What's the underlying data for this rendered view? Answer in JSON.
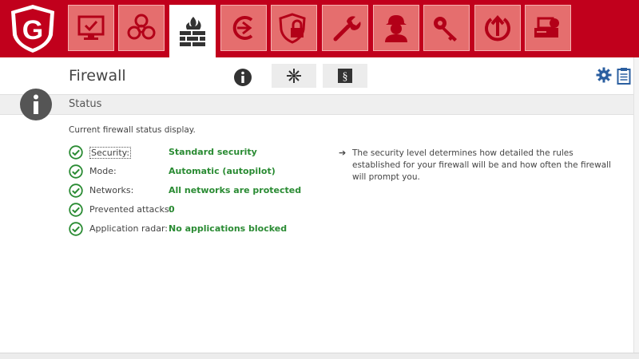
{
  "app": {
    "logo_letter": "G"
  },
  "modules": [
    {
      "name": "status-monitor-icon"
    },
    {
      "name": "biohazard-icon"
    },
    {
      "name": "firewall-icon"
    },
    {
      "name": "backup-icon"
    },
    {
      "name": "password-manager-icon"
    },
    {
      "name": "tuner-icon"
    },
    {
      "name": "parental-controls-icon"
    },
    {
      "name": "encryption-key-icon"
    },
    {
      "name": "autostart-manager-icon"
    },
    {
      "name": "device-control-icon"
    }
  ],
  "header": {
    "title": "Firewall",
    "subtabs": [
      {
        "name": "status-info-icon"
      },
      {
        "name": "network-icon"
      },
      {
        "name": "ruleset-icon"
      }
    ]
  },
  "status": {
    "title": "Status",
    "description": "Current firewall status display.",
    "rows": [
      {
        "label": "Security:",
        "value": "Standard security"
      },
      {
        "label": "Mode:",
        "value": "Automatic (autopilot)"
      },
      {
        "label": "Networks:",
        "value": "All networks are protected"
      },
      {
        "label": "Prevented attacks:",
        "value": "0"
      },
      {
        "label": "Application radar:",
        "value": "No applications blocked"
      }
    ],
    "hint_arrow": "➔",
    "hint": "The security level determines how detailed the rules established for your firewall will be and how often the firewall will prompt you."
  },
  "colors": {
    "brand": "#c1001c",
    "tile": "#e56e6e",
    "ok_green": "#2a8b33"
  }
}
